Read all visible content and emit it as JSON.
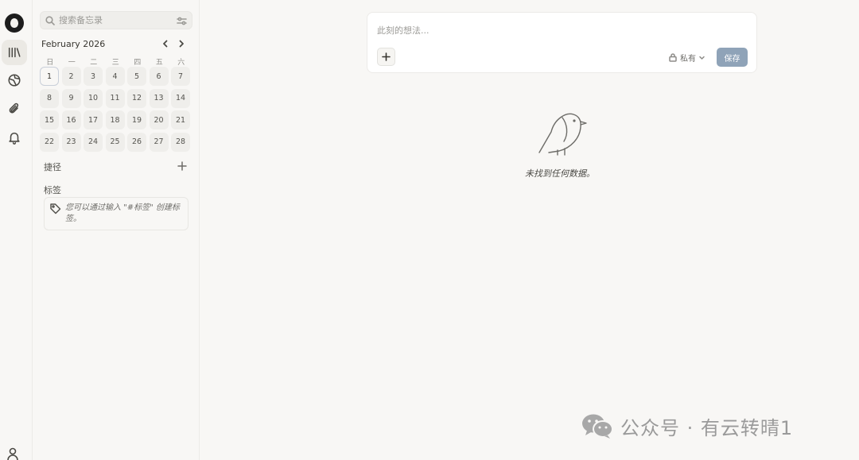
{
  "rail": {
    "items": [
      {
        "name": "memos",
        "icon": "library-icon",
        "active": true
      },
      {
        "name": "explore",
        "icon": "globe-icon",
        "active": false
      },
      {
        "name": "resources",
        "icon": "paperclip-icon",
        "active": false
      },
      {
        "name": "inbox",
        "icon": "bell-icon",
        "active": false
      }
    ],
    "bottom_icon": "user-icon"
  },
  "sidebar": {
    "search_placeholder": "搜索备忘录",
    "calendar": {
      "title": "February 2026",
      "weekdays": [
        "日",
        "一",
        "二",
        "三",
        "四",
        "五",
        "六"
      ],
      "days": [
        "1",
        "2",
        "3",
        "4",
        "5",
        "6",
        "7",
        "8",
        "9",
        "10",
        "11",
        "12",
        "13",
        "14",
        "15",
        "16",
        "17",
        "18",
        "19",
        "20",
        "21",
        "22",
        "23",
        "24",
        "25",
        "26",
        "27",
        "28"
      ],
      "today": "1"
    },
    "shortcuts_label": "捷径",
    "tags_label": "标签",
    "tags_hint": "您可以通过输入 \"#标签\" 创建标签。"
  },
  "editor": {
    "placeholder": "此刻的想法...",
    "visibility": "私有",
    "save_label": "保存"
  },
  "empty_state": {
    "message": "未找到任何数据。"
  },
  "watermark": {
    "text": "公众号 · 有云转晴1"
  },
  "colors": {
    "background": "#f8f7f5",
    "save_button": "#8fa3b8",
    "today_border": "#c9cfd9"
  }
}
